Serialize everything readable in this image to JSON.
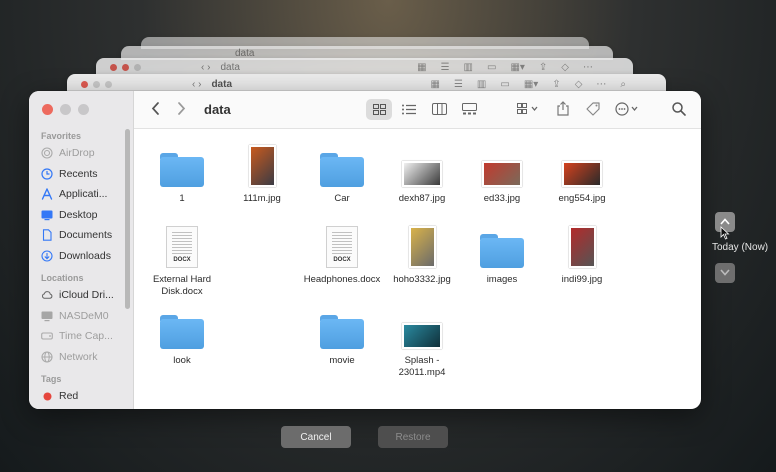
{
  "window": {
    "title": "data",
    "ghost_title": "data"
  },
  "sidebar": {
    "favorites_header": "Favorites",
    "favorites": [
      {
        "label": "AirDrop",
        "icon": "airdrop-icon",
        "dim": true
      },
      {
        "label": "Recents",
        "icon": "clock-icon",
        "dim": false
      },
      {
        "label": "Applicati...",
        "icon": "applications-icon",
        "dim": false
      },
      {
        "label": "Desktop",
        "icon": "desktop-icon",
        "dim": false
      },
      {
        "label": "Documents",
        "icon": "document-icon",
        "dim": false
      },
      {
        "label": "Downloads",
        "icon": "download-icon",
        "dim": false
      }
    ],
    "locations_header": "Locations",
    "locations": [
      {
        "label": "iCloud Dri...",
        "icon": "cloud-icon",
        "dim": false
      },
      {
        "label": "NASDeM0",
        "icon": "display-icon",
        "dim": true
      },
      {
        "label": "Time Cap...",
        "icon": "disk-icon",
        "dim": true
      },
      {
        "label": "Network",
        "icon": "globe-icon",
        "dim": true
      }
    ],
    "tags_header": "Tags",
    "tags": [
      {
        "label": "Red",
        "color": "#e5463d"
      }
    ]
  },
  "files": [
    {
      "name": "1",
      "kind": "folder"
    },
    {
      "name": "111m.jpg",
      "kind": "photo-tall",
      "colors": [
        "#c85a1e",
        "#3b3b44"
      ]
    },
    {
      "name": "Car",
      "kind": "folder"
    },
    {
      "name": "dexh87.jpg",
      "kind": "photo",
      "colors": [
        "#f0f0f0",
        "#3a3a3a"
      ]
    },
    {
      "name": "ed33.jpg",
      "kind": "photo",
      "colors": [
        "#c23a2e",
        "#7a6a5a"
      ]
    },
    {
      "name": "eng554.jpg",
      "kind": "photo",
      "colors": [
        "#d5421e",
        "#2a2a2a"
      ]
    },
    {
      "name": "External Hard Disk.docx",
      "kind": "doc"
    },
    {
      "name": "Headphones.docx",
      "kind": "doc"
    },
    {
      "name": "hoho3332.jpg",
      "kind": "photo-tall",
      "colors": [
        "#d9b24a",
        "#6a6a6a"
      ]
    },
    {
      "name": "images",
      "kind": "folder"
    },
    {
      "name": "indi99.jpg",
      "kind": "photo-tall",
      "colors": [
        "#b32a2a",
        "#555"
      ]
    },
    {
      "name": "look",
      "kind": "folder"
    },
    {
      "name": "movie",
      "kind": "folder"
    },
    {
      "name": "Splash - 23011.mp4",
      "kind": "photo",
      "colors": [
        "#2a8aa0",
        "#10303a"
      ]
    }
  ],
  "doc_tag": "DOCX",
  "timeline": {
    "label": "Today (Now)"
  },
  "buttons": {
    "cancel": "Cancel",
    "restore": "Restore"
  },
  "colors": {
    "folder": "#5aa6e6",
    "close": "#ed6a5e"
  }
}
